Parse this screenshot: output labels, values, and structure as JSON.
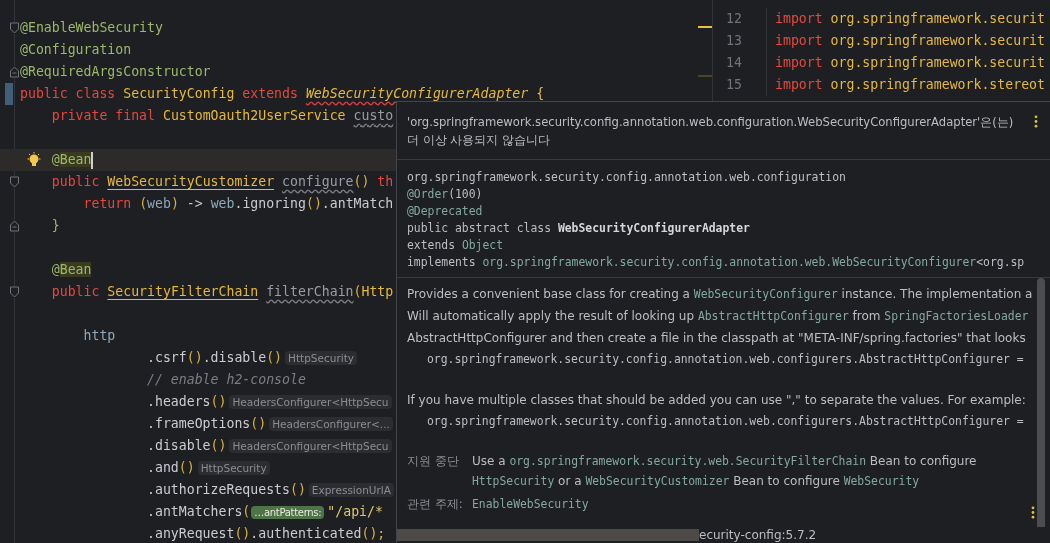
{
  "editor": {
    "lines": [
      {
        "tokens": [
          {
            "text": "@EnableWebSecurity",
            "kind": "annotation"
          }
        ],
        "fold": {
          "kind": "start"
        },
        "current": false,
        "modified": false
      },
      {
        "tokens": [
          {
            "text": "@Configuration",
            "kind": "annotation"
          }
        ],
        "current": false,
        "modified": false
      },
      {
        "tokens": [
          {
            "text": "@RequiredArgsConstructor",
            "kind": "annotation"
          }
        ],
        "fold": {
          "kind": "end"
        },
        "current": false,
        "modified": false
      },
      {
        "tokens": [
          {
            "text": "public",
            "kind": "keyword"
          },
          {
            "text": " class",
            "kind": "keyword"
          },
          {
            "text": " SecurityConfig",
            "kind": "type"
          },
          {
            "text": " extends",
            "kind": "keyword"
          },
          {
            "text": " WebSecurityConfigurerAdapter",
            "kind": "deprecated"
          },
          {
            "text": " {",
            "kind": "type"
          }
        ],
        "current": false,
        "modified": true
      },
      {
        "tokens": [
          {
            "text": "    private final",
            "kind": "keyword"
          },
          {
            "text": " CustomOauth2UserService ",
            "kind": "type"
          },
          {
            "text": "custo",
            "kind": "unused"
          }
        ],
        "current": false,
        "modified": false
      },
      {
        "current": false,
        "modified": false
      },
      {
        "tokens": [
          {
            "text": "    @",
            "kind": "annotation"
          },
          {
            "text": "Bean",
            "kind": "bean"
          }
        ],
        "current": true,
        "modified": false
      },
      {
        "tokens": [
          {
            "text": "    public",
            "kind": "keyword"
          },
          {
            "text": " WebSecurityCustomizer",
            "kind": "bean-type"
          },
          {
            "text": " configure",
            "kind": "unused"
          },
          {
            "text": "()",
            "kind": "paren"
          },
          {
            "text": " th",
            "kind": "keyword"
          }
        ],
        "fold": {
          "kind": "start"
        },
        "current": false,
        "modified": false
      },
      {
        "tokens": [
          {
            "text": "        return",
            "kind": "keyword"
          },
          {
            "text": " (",
            "kind": "paren"
          },
          {
            "text": "web",
            "kind": "param"
          },
          {
            "text": ")",
            "kind": "paren"
          },
          {
            "text": " -> ",
            "kind": "plain"
          },
          {
            "text": "web",
            "kind": "param"
          },
          {
            "text": ".ignoring",
            "kind": "plain"
          },
          {
            "text": "()",
            "kind": "paren"
          },
          {
            "text": ".antMatch",
            "kind": "plain"
          }
        ],
        "current": false,
        "modified": false
      },
      {
        "tokens": [
          {
            "text": "    }",
            "kind": "brace"
          }
        ],
        "fold": {
          "kind": "end"
        },
        "current": false,
        "modified": false
      },
      {
        "current": false,
        "modified": false
      },
      {
        "tokens": [
          {
            "text": "    @",
            "kind": "annotation"
          },
          {
            "text": "Bean",
            "kind": "bean"
          }
        ],
        "current": false,
        "modified": false
      },
      {
        "tokens": [
          {
            "text": "    public",
            "kind": "keyword"
          },
          {
            "text": " SecurityFilterChain",
            "kind": "bean-type"
          },
          {
            "text": " filterChain",
            "kind": "unused"
          },
          {
            "text": "(",
            "kind": "paren"
          },
          {
            "text": "Http",
            "kind": "type"
          }
        ],
        "fold": {
          "kind": "start"
        },
        "current": false,
        "modified": false
      },
      {
        "current": false,
        "modified": false
      },
      {
        "tokens": [
          {
            "text": "        http",
            "kind": "param"
          }
        ],
        "current": false,
        "modified": false
      },
      {
        "tokens": [
          {
            "text": "                .csrf",
            "kind": "plain"
          },
          {
            "text": "()",
            "kind": "paren"
          },
          {
            "text": ".disable",
            "kind": "plain"
          },
          {
            "text": "()",
            "kind": "paren"
          },
          {
            "text": "HttpSecurity",
            "kind": "hint"
          }
        ],
        "current": false,
        "modified": false
      },
      {
        "tokens": [
          {
            "text": "                // enable h2-console",
            "kind": "comment"
          }
        ],
        "current": false,
        "modified": false
      },
      {
        "tokens": [
          {
            "text": "                .headers",
            "kind": "plain"
          },
          {
            "text": "()",
            "kind": "paren"
          },
          {
            "text": "HeadersConfigurer<HttpSecu",
            "kind": "hint"
          }
        ],
        "current": false,
        "modified": false
      },
      {
        "tokens": [
          {
            "text": "                .frameOptions",
            "kind": "plain"
          },
          {
            "text": "()",
            "kind": "paren"
          },
          {
            "text": "HeadersConfigurer<...",
            "kind": "hint"
          }
        ],
        "current": false,
        "modified": false
      },
      {
        "tokens": [
          {
            "text": "                .disable",
            "kind": "plain"
          },
          {
            "text": "()",
            "kind": "paren"
          },
          {
            "text": "HeadersConfigurer<HttpSecu",
            "kind": "hint"
          }
        ],
        "current": false,
        "modified": false
      },
      {
        "tokens": [
          {
            "text": "                .and",
            "kind": "plain"
          },
          {
            "text": "()",
            "kind": "paren"
          },
          {
            "text": "HttpSecurity",
            "kind": "hint"
          }
        ],
        "current": false,
        "modified": false
      },
      {
        "tokens": [
          {
            "text": "                .authorizeRequests",
            "kind": "plain"
          },
          {
            "text": "()",
            "kind": "paren"
          },
          {
            "text": "ExpressionUrlA",
            "kind": "hint"
          }
        ],
        "current": false,
        "modified": false
      },
      {
        "tokens": [
          {
            "text": "                .antMatchers",
            "kind": "plain"
          },
          {
            "text": "(",
            "kind": "paren"
          },
          {
            "text": "…antPatterns:",
            "kind": "param-hint"
          },
          {
            "text": "\"/api/*",
            "kind": "string"
          }
        ],
        "current": false,
        "modified": false
      },
      {
        "tokens": [
          {
            "text": "                .anyRequest",
            "kind": "plain"
          },
          {
            "text": "()",
            "kind": "paren"
          },
          {
            "text": ".authenticated",
            "kind": "plain"
          },
          {
            "text": "();",
            "kind": "paren"
          }
        ],
        "current": false,
        "modified": false
      }
    ]
  },
  "side_editor": {
    "lines": [
      {
        "number": "12",
        "tokens": [
          {
            "text": "import",
            "kind": "keyword"
          },
          {
            "text": " org.springframework.securit",
            "kind": "type"
          }
        ]
      },
      {
        "number": "13",
        "tokens": [
          {
            "text": "import",
            "kind": "keyword"
          },
          {
            "text": " org.springframework.securit",
            "kind": "type"
          }
        ]
      },
      {
        "number": "14",
        "tokens": [
          {
            "text": "import",
            "kind": "keyword"
          },
          {
            "text": " org.springframework.securit",
            "kind": "type"
          }
        ]
      },
      {
        "number": "15",
        "tokens": [
          {
            "text": "import",
            "kind": "keyword"
          },
          {
            "text": " org.springframework.stereot",
            "kind": "type"
          }
        ]
      }
    ]
  },
  "doc_popup": {
    "header": "'org.springframework.security.config.annotation.web.configuration.WebSecurityConfigurerAdapter'은(는) 더 이상 사용되지 않습니다",
    "signature": [
      {
        "tokens": [
          {
            "text": "org.springframework.security.config.annotation.web.configuration",
            "kind": "plain"
          }
        ]
      },
      {
        "tokens": [
          {
            "text": "@Order",
            "kind": "ref"
          },
          {
            "text": "(100)",
            "kind": "plain"
          }
        ]
      },
      {
        "tokens": [
          {
            "text": "@Deprecated",
            "kind": "ref"
          }
        ]
      },
      {
        "tokens": [
          {
            "text": "public abstract class ",
            "kind": "plain"
          },
          {
            "text": "WebSecurityConfigurerAdapter",
            "kind": "bold"
          }
        ]
      },
      {
        "tokens": [
          {
            "text": "extends ",
            "kind": "plain"
          },
          {
            "text": "Object",
            "kind": "ref"
          }
        ]
      },
      {
        "tokens": [
          {
            "text": "implements ",
            "kind": "plain"
          },
          {
            "text": "org.springframework.security.config.annotation.web.WebSecurityConfigurer",
            "kind": "ref"
          },
          {
            "text": "<org.sp",
            "kind": "plain"
          }
        ]
      }
    ],
    "blocks": [
      {
        "kind": "prose",
        "lines": [
          {
            "tokens": [
              {
                "text": "Provides a convenient base class for creating a ",
                "kind": "plain"
              },
              {
                "text": "WebSecurityConfigurer",
                "kind": "ref"
              },
              {
                "text": " instance. The implementation a",
                "kind": "plain"
              }
            ]
          },
          {
            "tokens": [
              {
                "text": "Will automatically apply the result of looking up ",
                "kind": "plain"
              },
              {
                "text": "AbstractHttpConfigurer",
                "kind": "ref"
              },
              {
                "text": " from ",
                "kind": "plain"
              },
              {
                "text": "SpringFactoriesLoader",
                "kind": "ref"
              }
            ]
          },
          {
            "tokens": [
              {
                "text": "AbstractHttpConfigurer and then create a file in the classpath at \"META-INF/spring.factories\" that looks",
                "kind": "plain"
              }
            ]
          }
        ]
      },
      {
        "kind": "code",
        "text": "org.springframework.security.config.annotation.web.configurers.AbstractHttpConfigurer ="
      },
      {
        "kind": "prose",
        "lines": [
          {
            "tokens": [
              {
                "text": "If you have multiple classes that should be added you can use \",\" to separate the values. For example:",
                "kind": "plain"
              }
            ]
          }
        ]
      },
      {
        "kind": "code",
        "text": "org.springframework.security.config.annotation.web.configurers.AbstractHttpConfigurer ="
      }
    ],
    "sections": [
      {
        "label": "지원 중단",
        "lines": [
          {
            "tokens": [
              {
                "text": "Use a ",
                "kind": "plain"
              },
              {
                "text": "org.springframework.security.web.SecurityFilterChain",
                "kind": "ref"
              },
              {
                "text": " Bean to configure",
                "kind": "plain"
              }
            ]
          },
          {
            "tokens": [
              {
                "text": "HttpSecurity",
                "kind": "ref"
              },
              {
                "text": " or a ",
                "kind": "plain"
              },
              {
                "text": "WebSecurityCustomizer",
                "kind": "ref"
              },
              {
                "text": " Bean to configure ",
                "kind": "plain"
              },
              {
                "text": "WebSecurity",
                "kind": "ref"
              }
            ]
          }
        ]
      },
      {
        "label": "관련 주제:",
        "lines": [
          {
            "tokens": [
              {
                "text": "EnableWebSecurity",
                "kind": "ref"
              }
            ]
          }
        ]
      }
    ],
    "footer": "ecurity-config:5.7.2"
  }
}
